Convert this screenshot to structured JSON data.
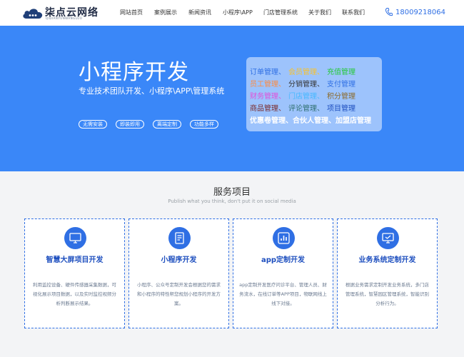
{
  "header": {
    "logo_name": "柒点云网络",
    "logo_sub": "QIDIANYUNWANGLUO",
    "nav": [
      {
        "label": "网站首页"
      },
      {
        "label": "案例展示"
      },
      {
        "label": "新闻资讯"
      },
      {
        "label": "小程序\\APP"
      },
      {
        "label": "门店管理系统"
      },
      {
        "label": "关于我们"
      },
      {
        "label": "联系我们"
      }
    ],
    "phone": "18009218064"
  },
  "banner": {
    "title": "小程序开发",
    "subtitle": "专业技术团队开发、小程序\\APP\\管理系统",
    "tags": [
      "无需安装",
      "即装即用",
      "离端定制",
      "功能多样"
    ],
    "features": [
      [
        {
          "text": "订单管理、",
          "color": "#2f6fe4"
        },
        {
          "text": "会员管理、",
          "color": "#f8c22c"
        },
        {
          "text": "充值管理",
          "color": "#26c93a"
        }
      ],
      [
        {
          "text": "员工管理、",
          "color": "#ff8a3d"
        },
        {
          "text": "分销管理、",
          "color": "#333333"
        },
        {
          "text": "支付管理",
          "color": "#2f6fe4"
        }
      ],
      [
        {
          "text": "财务管理、",
          "color": "#e24fd8"
        },
        {
          "text": "门店管理、",
          "color": "#46b8ff"
        },
        {
          "text": "积分管理",
          "color": "#8b6a2a"
        }
      ],
      [
        {
          "text": "商品管理、",
          "color": "#7a2a2a"
        },
        {
          "text": "评论管理、",
          "color": "#2f6f6f"
        },
        {
          "text": "项目管理",
          "color": "#1e4fbf"
        }
      ],
      [
        {
          "text": "优惠卷管理、合伙人管理、加盟店管理",
          "color": "#ffffff"
        }
      ]
    ]
  },
  "services": {
    "title": "服务项目",
    "subtitle": "Publish what you think, don't put it on social media",
    "cards": [
      {
        "icon": "monitor-icon",
        "title": "智慧大屏项目开发",
        "desc": "利用监控设备、硬件传感器采集数据，可视化展示项目数据，以及实时监控视频分析判断展示结果。"
      },
      {
        "icon": "document-icon",
        "title": "小程序开发",
        "desc": "小程序、公众号定制开发会根据您的需求和小程序的特性帮您规划小程序的开发方案。"
      },
      {
        "icon": "chart-icon",
        "title": "app定制开发",
        "desc": "app定制开发医疗问诊平台、管理人员、财务流水，在线订单等APP项目，物联网线上线下对接。"
      },
      {
        "icon": "screen-icon",
        "title": "业务系统定制开发",
        "desc": "根据业务需求定制开发业务系统，多门店管理系统，智慧园区管理系统，智能识别分析行为。"
      }
    ]
  }
}
